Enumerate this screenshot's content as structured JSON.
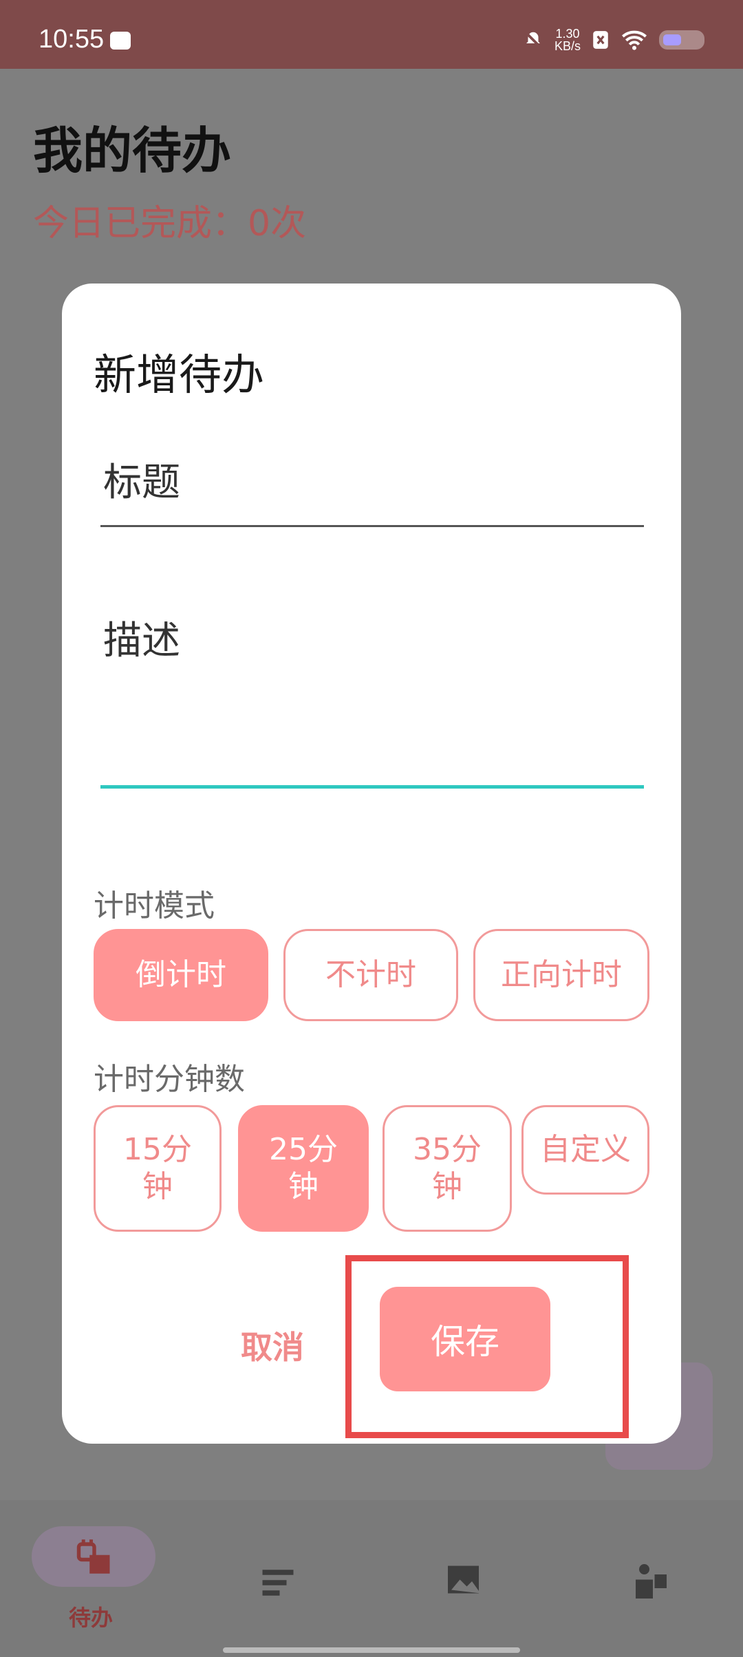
{
  "status_bar": {
    "time": "10:55",
    "speed_value": "1.30",
    "speed_unit": "KB/s"
  },
  "page": {
    "title": "我的待办",
    "subtitle": "今日已完成：0次"
  },
  "dialog": {
    "title": "新增待办",
    "title_field_placeholder": "标题",
    "desc_field_placeholder": "描述",
    "timer_mode_label": "计时模式",
    "timer_modes": [
      "倒计时",
      "不计时",
      "正向计时"
    ],
    "selected_timer_mode": "倒计时",
    "minutes_label": "计时分钟数",
    "minute_options": [
      "15分\n钟",
      "25分\n钟",
      "35分\n钟",
      "自定义"
    ],
    "selected_minute_option": "25分钟",
    "cancel_label": "取消",
    "save_label": "保存"
  },
  "bottom_nav": {
    "active_label": "待办"
  },
  "colors": {
    "accent": "#ff9494",
    "focus_line": "#2fc8c0",
    "highlight": "#e84b4b"
  }
}
